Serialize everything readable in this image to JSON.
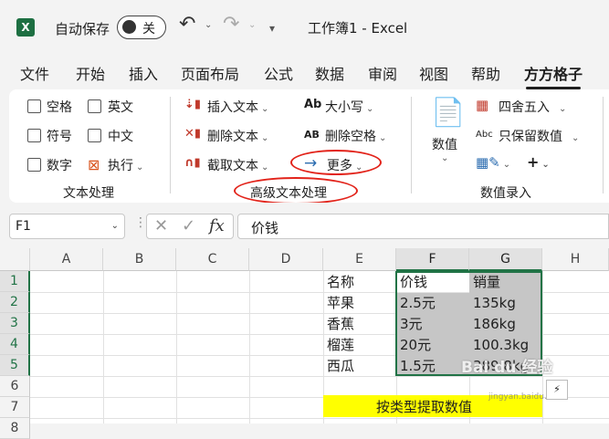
{
  "title_bar": {
    "app_logo": "X",
    "autosave_label": "自动保存",
    "autosave_state": "关",
    "document_title": "工作簿1  -  Excel"
  },
  "tabs": [
    "文件",
    "开始",
    "插入",
    "页面布局",
    "公式",
    "数据",
    "审阅",
    "视图",
    "帮助",
    "方方格子"
  ],
  "active_tab": "方方格子",
  "ribbon": {
    "text_group": {
      "checkboxes": [
        "空格",
        "英文",
        "符号",
        "中文",
        "数字"
      ],
      "execute_label": "执行",
      "group_label": "文本处理"
    },
    "advanced_group": {
      "insert_text": "插入文本",
      "delete_text": "删除文本",
      "extract_text": "截取文本",
      "case_label": "大小写",
      "case_icon": "Ab",
      "delete_space": "删除空格",
      "delete_space_icon": "AB",
      "more_label": "更多",
      "group_label": "高级文本处理"
    },
    "numeric_group": {
      "numeric_label": "数值",
      "round_label": "四舍五入",
      "keep_numeric_label": "只保留数值",
      "keep_icon": "Abc",
      "plus_label": "+",
      "group_label": "数值录入"
    }
  },
  "formula_bar": {
    "name_box": "F1",
    "fx_label": "fx",
    "formula_value": "价钱"
  },
  "sheet": {
    "columns": [
      "A",
      "B",
      "C",
      "D",
      "E",
      "F",
      "G",
      "H"
    ],
    "rows": [
      "1",
      "2",
      "3",
      "4",
      "5",
      "6",
      "7",
      "8"
    ],
    "col_e": [
      "名称",
      "苹果",
      "香蕉",
      "榴莲",
      "西瓜"
    ],
    "col_f": [
      "价钱",
      "2.5元",
      "3元",
      "20元",
      "1.5元"
    ],
    "col_g": [
      "销量",
      "135kg",
      "186kg",
      "100.3kg",
      "389.8kg"
    ],
    "banner": "按类型提取数值"
  },
  "watermark": "Bai du 经验",
  "watermark_url": "jingyan.baidu.com",
  "colors": {
    "accent": "#217346",
    "highlight": "#ffff00",
    "annotation_red": "#e2231a"
  }
}
